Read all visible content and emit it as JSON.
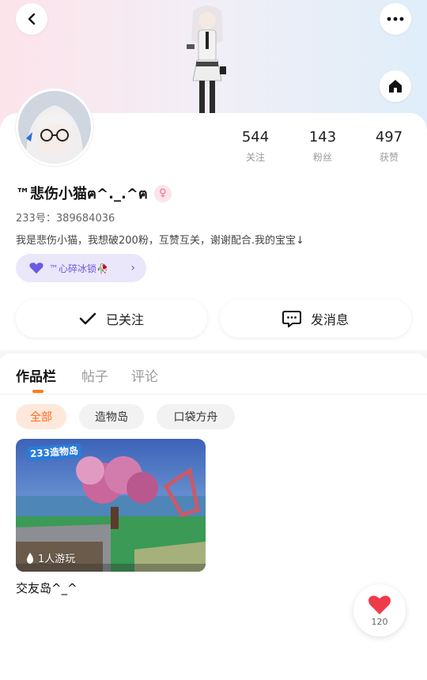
{
  "profile": {
    "username": "™悲伤小猫ฅ^._.^ฅ",
    "gender_symbol": "♀",
    "uid_text": "233号：389684036",
    "bio": "我是悲伤小猫，我想破200粉，互赞互关，谢谢配合.我的宝宝↓",
    "tag_label": "™心碎冰锁🥀"
  },
  "stats": [
    {
      "value": "544",
      "label": "关注"
    },
    {
      "value": "143",
      "label": "粉丝"
    },
    {
      "value": "497",
      "label": "获赞"
    }
  ],
  "actions": {
    "follow_label": "已关注",
    "message_label": "发消息"
  },
  "tabs": [
    {
      "label": "作品栏",
      "active": true
    },
    {
      "label": "帖子",
      "active": false
    },
    {
      "label": "评论",
      "active": false
    }
  ],
  "chips": [
    {
      "label": "全部",
      "active": true
    },
    {
      "label": "造物岛",
      "active": false
    },
    {
      "label": "口袋方舟",
      "active": false
    }
  ],
  "work": {
    "badge": "233造物岛",
    "players": "1人游玩",
    "title": "交友岛^_^"
  },
  "like": {
    "count": "120"
  },
  "icons": {
    "back": "back-arrow-icon",
    "more": "more-dots-icon",
    "home": "home-icon",
    "check": "check-icon",
    "message": "message-icon",
    "heart": "heart-icon",
    "flame": "flame-icon"
  },
  "colors": {
    "accent": "#ff7a1a",
    "tag_purple": "#6a5ae0",
    "like_red": "#ef3a4a"
  }
}
